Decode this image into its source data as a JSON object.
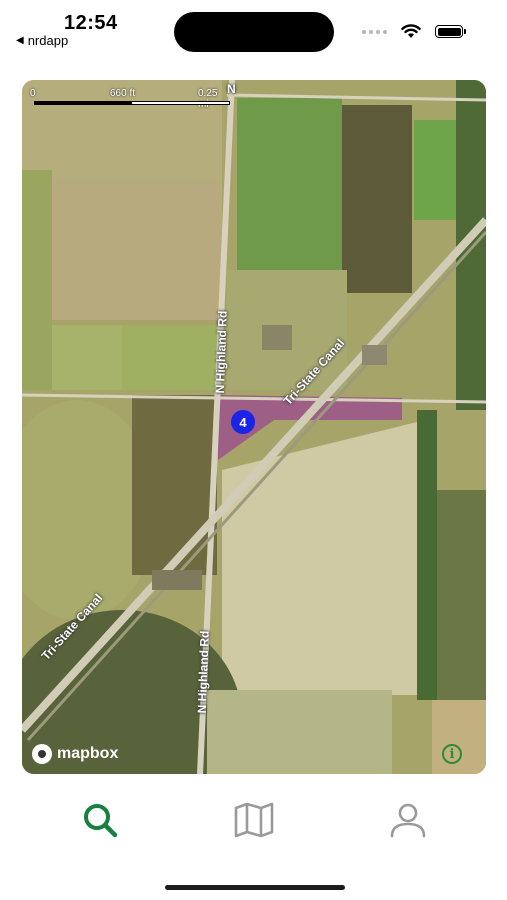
{
  "status_bar": {
    "time": "12:54",
    "back_app": "nrdapp",
    "icons": [
      "signal-dots-icon",
      "wifi-icon",
      "battery-icon"
    ]
  },
  "map": {
    "scale": {
      "start": "0",
      "mid": "660 ft",
      "end": "0.25 mi"
    },
    "road_labels": {
      "north_top": "N",
      "highland_north": "N Highland Rd",
      "highland_south": "N Highland Rd",
      "canal_north": "Tri-State Canal",
      "canal_south": "Tri-State Canal"
    },
    "marker_count": "4",
    "attribution": "mapbox",
    "info_symbol": "i",
    "colors": {
      "marker": "#1a23e6",
      "parcel_highlight": "#9b4f8c",
      "info_green": "#2c8a3a"
    }
  },
  "tabbar": {
    "tabs": [
      {
        "icon": "search-icon",
        "active": true
      },
      {
        "icon": "map-icon",
        "active": false
      },
      {
        "icon": "profile-icon",
        "active": false
      }
    ],
    "active_color": "#17803f",
    "inactive_color": "#9a9a9a"
  }
}
